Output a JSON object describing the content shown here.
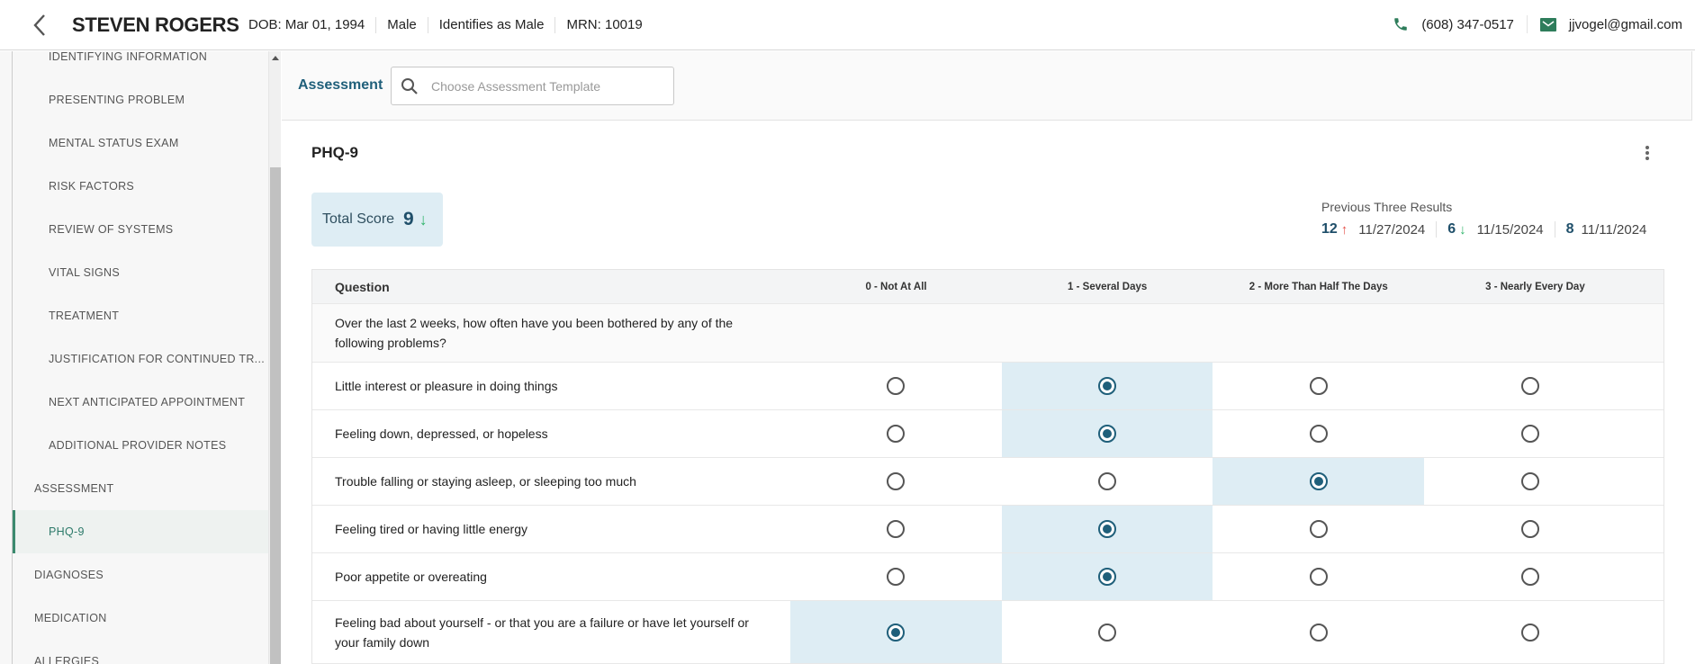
{
  "patient": {
    "name": "STEVEN ROGERS",
    "dob": "DOB: Mar 01, 1994",
    "sex": "Male",
    "gender": "Identifies as Male",
    "mrn": "MRN: 10019",
    "phone": "(608) 347-0517",
    "email": "jjvogel@gmail.com"
  },
  "sidebar": {
    "items": [
      {
        "label": "IDENTIFYING INFORMATION",
        "level": "sub"
      },
      {
        "label": "PRESENTING PROBLEM",
        "level": "sub"
      },
      {
        "label": "MENTAL STATUS EXAM",
        "level": "sub"
      },
      {
        "label": "RISK FACTORS",
        "level": "sub"
      },
      {
        "label": "REVIEW OF SYSTEMS",
        "level": "sub"
      },
      {
        "label": "VITAL SIGNS",
        "level": "sub"
      },
      {
        "label": "TREATMENT",
        "level": "sub"
      },
      {
        "label": "JUSTIFICATION FOR CONTINUED TR...",
        "level": "sub"
      },
      {
        "label": "NEXT ANTICIPATED APPOINTMENT",
        "level": "sub"
      },
      {
        "label": "ADDITIONAL PROVIDER NOTES",
        "level": "sub"
      },
      {
        "label": "ASSESSMENT",
        "level": "top"
      },
      {
        "label": "PHQ-9",
        "level": "active"
      },
      {
        "label": "DIAGNOSES",
        "level": "top"
      },
      {
        "label": "MEDICATION",
        "level": "top"
      },
      {
        "label": "ALLERGIES",
        "level": "top"
      }
    ]
  },
  "assessment": {
    "label": "Assessment",
    "search_placeholder": "Choose Assessment Template",
    "search_value": ""
  },
  "form": {
    "title": "PHQ-9",
    "total_label": "Total Score",
    "total_value": "9",
    "total_trend": "down",
    "previous_label": "Previous Three Results",
    "previous": [
      {
        "score": "12",
        "trend": "up",
        "date": "11/27/2024"
      },
      {
        "score": "6",
        "trend": "down",
        "date": "11/15/2024"
      },
      {
        "score": "8",
        "trend": "none",
        "date": "11/11/2024"
      }
    ]
  },
  "table": {
    "headers": [
      "Question",
      "0 - Not At All",
      "1 - Several Days",
      "2 - More Than Half The Days",
      "3 - Nearly Every Day"
    ],
    "intro": "Over the last 2 weeks, how often have you been bothered by any of the following problems?",
    "rows": [
      {
        "question": "Little interest or pleasure in doing things",
        "selected": 1
      },
      {
        "question": "Feeling down, depressed, or hopeless",
        "selected": 1
      },
      {
        "question": "Trouble falling or staying asleep, or sleeping too much",
        "selected": 2
      },
      {
        "question": "Feeling tired or having little energy",
        "selected": 1
      },
      {
        "question": "Poor appetite or overeating",
        "selected": 1
      },
      {
        "question": "Feeling bad about yourself - or that you are a failure or have let yourself or your family down",
        "selected": 0
      }
    ]
  },
  "colors": {
    "accent": "#1f5f7a",
    "selected_bg": "#deedf4",
    "green": "#3b8a6e",
    "up": "#e5534b",
    "down": "#2fb36a"
  }
}
